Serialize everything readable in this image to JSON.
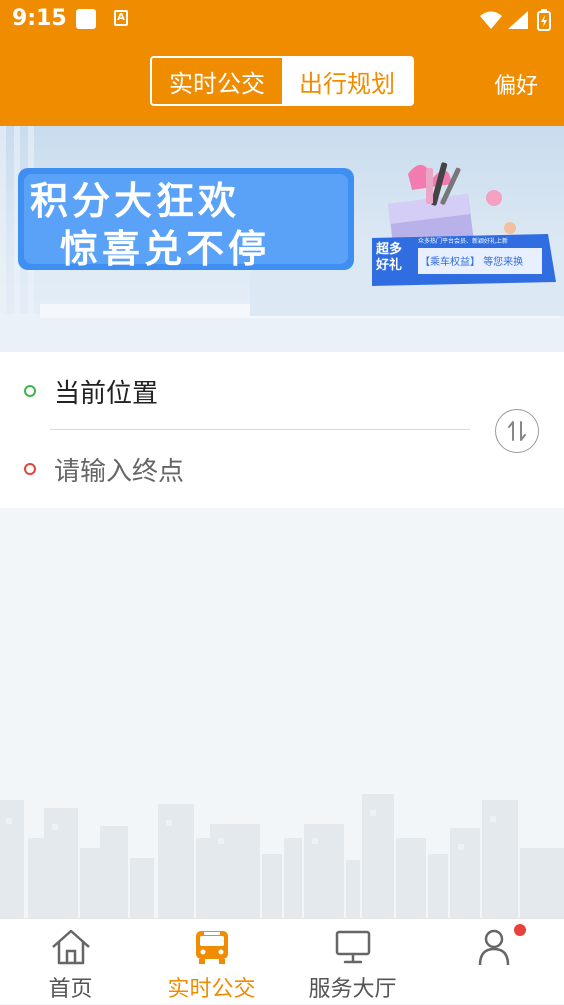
{
  "status_bar": {
    "time": "9:15",
    "notification_a": "A"
  },
  "header": {
    "tabs": [
      {
        "label": "实时公交",
        "active": false
      },
      {
        "label": "出行规划",
        "active": true
      }
    ],
    "preference_label": "偏好",
    "accent_color": "#f08c00"
  },
  "banner": {
    "headline_line1": "积分大狂欢",
    "headline_line2": "惊喜兑不停",
    "tag_line1": "超多",
    "tag_line2": "好礼",
    "caption_small": "众多热门平台会员、新颖好礼上新",
    "caption_bracket": "【乘车权益】",
    "caption_suffix": "等您来换"
  },
  "route": {
    "start_text": "当前位置",
    "end_placeholder": "请输入终点",
    "swap_icon": "swap-vertical-icon"
  },
  "tabbar": {
    "items": [
      {
        "label": "首页",
        "icon": "home-icon",
        "active": false
      },
      {
        "label": "实时公交",
        "icon": "bus-icon",
        "active": true
      },
      {
        "label": "服务大厅",
        "icon": "monitor-icon",
        "active": false
      },
      {
        "label": "",
        "icon": "user-icon",
        "active": false,
        "badge": true
      }
    ]
  }
}
